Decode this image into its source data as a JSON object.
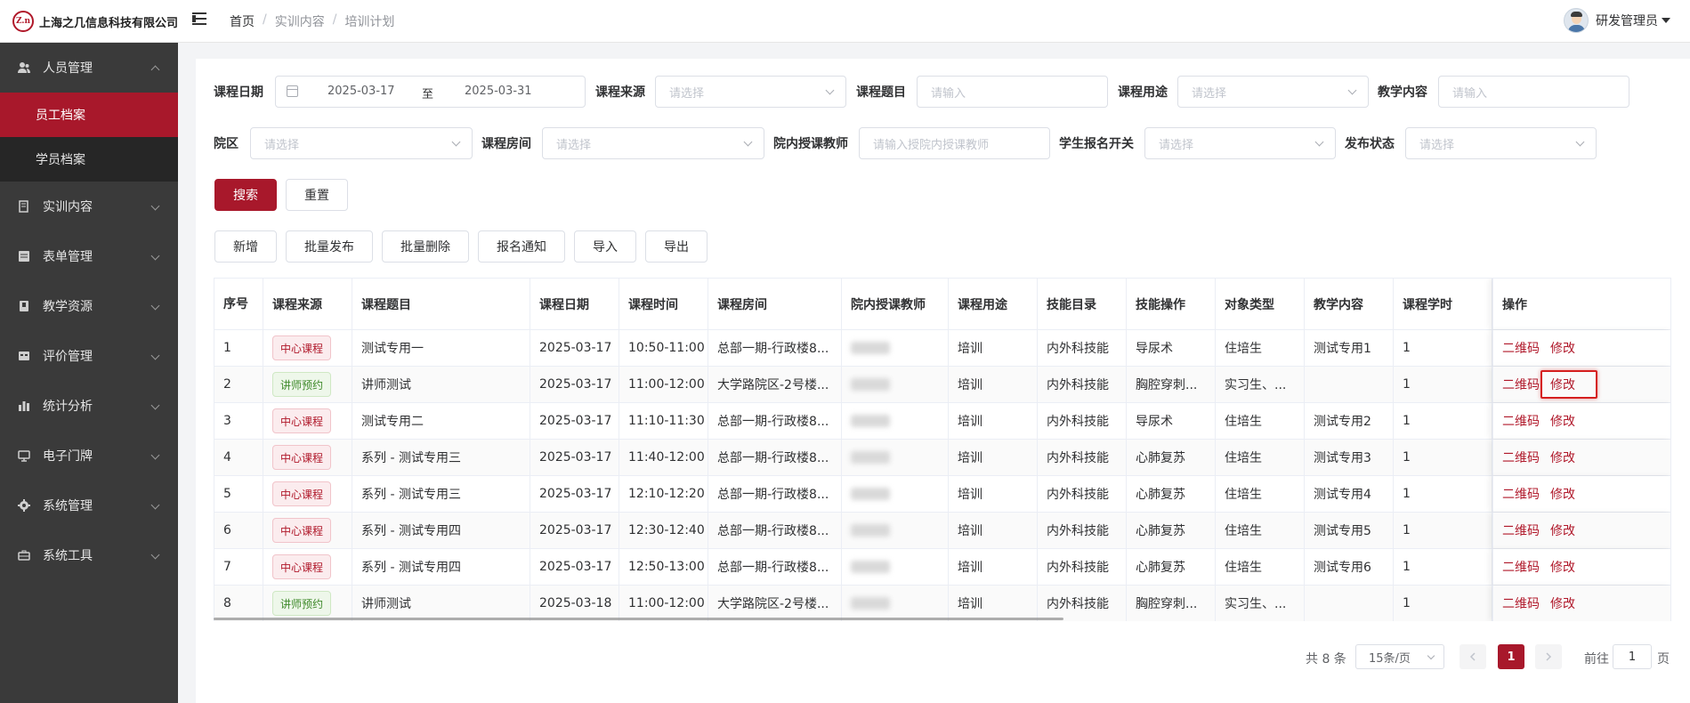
{
  "header": {
    "company": "上海之几信息科技有限公司",
    "logo_mark": "Z.n",
    "breadcrumb": [
      "首页",
      "实训内容",
      "培训计划"
    ],
    "user_name": "研发管理员"
  },
  "sidebar": {
    "items": [
      {
        "label": "人员管理",
        "icon": "users-icon",
        "expanded": true
      },
      {
        "label": "员工档案",
        "sub": true,
        "active": true
      },
      {
        "label": "学员档案",
        "sub": true,
        "active": false
      },
      {
        "label": "实训内容",
        "icon": "book-icon"
      },
      {
        "label": "表单管理",
        "icon": "form-icon"
      },
      {
        "label": "教学资源",
        "icon": "resource-icon"
      },
      {
        "label": "评价管理",
        "icon": "evaluation-icon"
      },
      {
        "label": "统计分析",
        "icon": "bar-chart-icon"
      },
      {
        "label": "电子门牌",
        "icon": "monitor-icon"
      },
      {
        "label": "系统管理",
        "icon": "gear-icon"
      },
      {
        "label": "系统工具",
        "icon": "toolbox-icon"
      }
    ]
  },
  "filters": {
    "course_date": {
      "label": "课程日期",
      "start": "2025-03-17",
      "sep": "至",
      "end": "2025-03-31"
    },
    "course_source": {
      "label": "课程来源",
      "placeholder": "请选择"
    },
    "course_title": {
      "label": "课程题目",
      "placeholder": "请输入"
    },
    "course_usage": {
      "label": "课程用途",
      "placeholder": "请选择"
    },
    "teaching_content": {
      "label": "教学内容",
      "placeholder": "请输入"
    },
    "campus": {
      "label": "院区",
      "placeholder": "请选择"
    },
    "course_room": {
      "label": "课程房间",
      "placeholder": "请选择"
    },
    "teacher": {
      "label": "院内授课教师",
      "placeholder": "请输入授院内授课教师"
    },
    "enroll_switch": {
      "label": "学生报名开关",
      "placeholder": "请选择"
    },
    "publish_status": {
      "label": "发布状态",
      "placeholder": "请选择"
    }
  },
  "buttons": {
    "search": "搜索",
    "reset": "重置",
    "add": "新增",
    "batch_publish": "批量发布",
    "batch_delete": "批量删除",
    "enroll_notice": "报名通知",
    "import": "导入",
    "export": "导出"
  },
  "table": {
    "headers": {
      "index": "序号",
      "source": "课程来源",
      "title": "课程题目",
      "date": "课程日期",
      "time": "课程时间",
      "room": "课程房间",
      "teacher": "院内授课教师",
      "usage": "课程用途",
      "skill_dir": "技能目录",
      "skill_op": "技能操作",
      "target": "对象类型",
      "content": "教学内容",
      "hours": "课程学时",
      "ops": "操作"
    },
    "op_qrcode": "二维码",
    "op_edit": "修改",
    "rows": [
      {
        "index": "1",
        "source": "中心课程",
        "source_type": "red",
        "title": "测试专用一",
        "date": "2025-03-17",
        "time": "10:50-11:00",
        "room": "总部一期-行政楼8...",
        "usage": "培训",
        "skill_dir": "内外科技能",
        "skill_op": "导尿术",
        "target": "住培生",
        "content": "测试专用1",
        "hours": "1"
      },
      {
        "index": "2",
        "source": "讲师预约",
        "source_type": "green",
        "title": "讲师测试",
        "date": "2025-03-17",
        "time": "11:00-12:00",
        "room": "大学路院区-2号楼...",
        "usage": "培训",
        "skill_dir": "内外科技能",
        "skill_op": "胸腔穿刺...",
        "target": "实习生、...",
        "content": "",
        "hours": "1"
      },
      {
        "index": "3",
        "source": "中心课程",
        "source_type": "red",
        "title": "测试专用二",
        "date": "2025-03-17",
        "time": "11:10-11:30",
        "room": "总部一期-行政楼8...",
        "usage": "培训",
        "skill_dir": "内外科技能",
        "skill_op": "导尿术",
        "target": "住培生",
        "content": "测试专用2",
        "hours": "1"
      },
      {
        "index": "4",
        "source": "中心课程",
        "source_type": "red",
        "title": "系列 - 测试专用三",
        "date": "2025-03-17",
        "time": "11:40-12:00",
        "room": "总部一期-行政楼8...",
        "usage": "培训",
        "skill_dir": "内外科技能",
        "skill_op": "心肺复苏",
        "target": "住培生",
        "content": "测试专用3",
        "hours": "1"
      },
      {
        "index": "5",
        "source": "中心课程",
        "source_type": "red",
        "title": "系列 - 测试专用三",
        "date": "2025-03-17",
        "time": "12:10-12:20",
        "room": "总部一期-行政楼8...",
        "usage": "培训",
        "skill_dir": "内外科技能",
        "skill_op": "心肺复苏",
        "target": "住培生",
        "content": "测试专用4",
        "hours": "1"
      },
      {
        "index": "6",
        "source": "中心课程",
        "source_type": "red",
        "title": "系列 - 测试专用四",
        "date": "2025-03-17",
        "time": "12:30-12:40",
        "room": "总部一期-行政楼8...",
        "usage": "培训",
        "skill_dir": "内外科技能",
        "skill_op": "心肺复苏",
        "target": "住培生",
        "content": "测试专用5",
        "hours": "1"
      },
      {
        "index": "7",
        "source": "中心课程",
        "source_type": "red",
        "title": "系列 - 测试专用四",
        "date": "2025-03-17",
        "time": "12:50-13:00",
        "room": "总部一期-行政楼8...",
        "usage": "培训",
        "skill_dir": "内外科技能",
        "skill_op": "心肺复苏",
        "target": "住培生",
        "content": "测试专用6",
        "hours": "1"
      },
      {
        "index": "8",
        "source": "讲师预约",
        "source_type": "green",
        "title": "讲师测试",
        "date": "2025-03-18",
        "time": "11:00-12:00",
        "room": "大学路院区-2号楼...",
        "usage": "培训",
        "skill_dir": "内外科技能",
        "skill_op": "胸腔穿刺...",
        "target": "实习生、...",
        "content": "",
        "hours": "1"
      }
    ]
  },
  "pagination": {
    "total": "共 8 条",
    "page_size": "15条/页",
    "current": "1",
    "goto_prefix": "前往",
    "goto_value": "1",
    "goto_suffix": "页"
  },
  "colors": {
    "brand": "#a8182b",
    "sidebar_bg": "#3a3a3a",
    "highlight": "#d51f1f"
  }
}
